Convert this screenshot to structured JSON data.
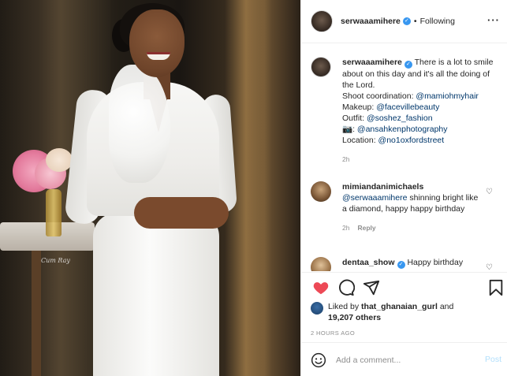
{
  "header": {
    "username": "serwaaamihere",
    "separator": "•",
    "follow_status": "Following",
    "more": "···"
  },
  "caption": {
    "username": "serwaaamihere",
    "text": "There is a lot to smile about on this day and it's all the doing of the Lord.",
    "shoot_label": "Shoot coordination:",
    "shoot_handle": "@mamiohmyhair",
    "makeup_label": "Makeup:",
    "makeup_handle": "@facevillebeauty",
    "outfit_label": "Outfit:",
    "outfit_handle": "@soshez_fashion",
    "camera_label": "📷:",
    "camera_handle": "@ansahkenphotography",
    "location_label": "Location:",
    "location_handle": "@no1oxfordstreet",
    "time": "2h"
  },
  "comments": [
    {
      "username": "mimiandanimichaels",
      "mention": "@serwaaamihere",
      "text": "shinning bright like a diamond, happy happy birthday",
      "time": "2h",
      "reply": "Reply"
    },
    {
      "username": "dentaa_show",
      "text": "Happy birthday"
    }
  ],
  "likes": {
    "prefix": "Liked by",
    "user": "that_ghanaian_gurl",
    "and": "and",
    "others": "19,207 others"
  },
  "timestamp": "2 HOURS AGO",
  "add_comment": {
    "placeholder": "Add a comment...",
    "post_label": "Post"
  },
  "photo": {
    "watermark": "Cum Ray"
  },
  "colors": {
    "like_red": "#ed4956",
    "verified_blue": "#3897f0",
    "link_blue": "#00376b",
    "post_disabled": "#b2dffc"
  }
}
